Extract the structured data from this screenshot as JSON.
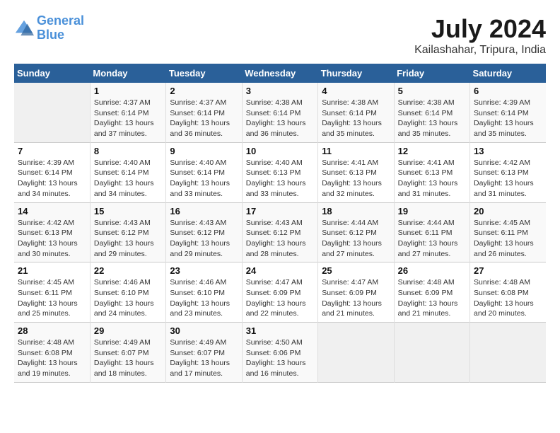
{
  "header": {
    "logo_line1": "General",
    "logo_line2": "Blue",
    "month_year": "July 2024",
    "location": "Kailashahar, Tripura, India"
  },
  "weekdays": [
    "Sunday",
    "Monday",
    "Tuesday",
    "Wednesday",
    "Thursday",
    "Friday",
    "Saturday"
  ],
  "weeks": [
    [
      {
        "day": "",
        "info": ""
      },
      {
        "day": "1",
        "info": "Sunrise: 4:37 AM\nSunset: 6:14 PM\nDaylight: 13 hours\nand 37 minutes."
      },
      {
        "day": "2",
        "info": "Sunrise: 4:37 AM\nSunset: 6:14 PM\nDaylight: 13 hours\nand 36 minutes."
      },
      {
        "day": "3",
        "info": "Sunrise: 4:38 AM\nSunset: 6:14 PM\nDaylight: 13 hours\nand 36 minutes."
      },
      {
        "day": "4",
        "info": "Sunrise: 4:38 AM\nSunset: 6:14 PM\nDaylight: 13 hours\nand 35 minutes."
      },
      {
        "day": "5",
        "info": "Sunrise: 4:38 AM\nSunset: 6:14 PM\nDaylight: 13 hours\nand 35 minutes."
      },
      {
        "day": "6",
        "info": "Sunrise: 4:39 AM\nSunset: 6:14 PM\nDaylight: 13 hours\nand 35 minutes."
      }
    ],
    [
      {
        "day": "7",
        "info": "Sunrise: 4:39 AM\nSunset: 6:14 PM\nDaylight: 13 hours\nand 34 minutes."
      },
      {
        "day": "8",
        "info": "Sunrise: 4:40 AM\nSunset: 6:14 PM\nDaylight: 13 hours\nand 34 minutes."
      },
      {
        "day": "9",
        "info": "Sunrise: 4:40 AM\nSunset: 6:14 PM\nDaylight: 13 hours\nand 33 minutes."
      },
      {
        "day": "10",
        "info": "Sunrise: 4:40 AM\nSunset: 6:13 PM\nDaylight: 13 hours\nand 33 minutes."
      },
      {
        "day": "11",
        "info": "Sunrise: 4:41 AM\nSunset: 6:13 PM\nDaylight: 13 hours\nand 32 minutes."
      },
      {
        "day": "12",
        "info": "Sunrise: 4:41 AM\nSunset: 6:13 PM\nDaylight: 13 hours\nand 31 minutes."
      },
      {
        "day": "13",
        "info": "Sunrise: 4:42 AM\nSunset: 6:13 PM\nDaylight: 13 hours\nand 31 minutes."
      }
    ],
    [
      {
        "day": "14",
        "info": "Sunrise: 4:42 AM\nSunset: 6:13 PM\nDaylight: 13 hours\nand 30 minutes."
      },
      {
        "day": "15",
        "info": "Sunrise: 4:43 AM\nSunset: 6:12 PM\nDaylight: 13 hours\nand 29 minutes."
      },
      {
        "day": "16",
        "info": "Sunrise: 4:43 AM\nSunset: 6:12 PM\nDaylight: 13 hours\nand 29 minutes."
      },
      {
        "day": "17",
        "info": "Sunrise: 4:43 AM\nSunset: 6:12 PM\nDaylight: 13 hours\nand 28 minutes."
      },
      {
        "day": "18",
        "info": "Sunrise: 4:44 AM\nSunset: 6:12 PM\nDaylight: 13 hours\nand 27 minutes."
      },
      {
        "day": "19",
        "info": "Sunrise: 4:44 AM\nSunset: 6:11 PM\nDaylight: 13 hours\nand 27 minutes."
      },
      {
        "day": "20",
        "info": "Sunrise: 4:45 AM\nSunset: 6:11 PM\nDaylight: 13 hours\nand 26 minutes."
      }
    ],
    [
      {
        "day": "21",
        "info": "Sunrise: 4:45 AM\nSunset: 6:11 PM\nDaylight: 13 hours\nand 25 minutes."
      },
      {
        "day": "22",
        "info": "Sunrise: 4:46 AM\nSunset: 6:10 PM\nDaylight: 13 hours\nand 24 minutes."
      },
      {
        "day": "23",
        "info": "Sunrise: 4:46 AM\nSunset: 6:10 PM\nDaylight: 13 hours\nand 23 minutes."
      },
      {
        "day": "24",
        "info": "Sunrise: 4:47 AM\nSunset: 6:09 PM\nDaylight: 13 hours\nand 22 minutes."
      },
      {
        "day": "25",
        "info": "Sunrise: 4:47 AM\nSunset: 6:09 PM\nDaylight: 13 hours\nand 21 minutes."
      },
      {
        "day": "26",
        "info": "Sunrise: 4:48 AM\nSunset: 6:09 PM\nDaylight: 13 hours\nand 21 minutes."
      },
      {
        "day": "27",
        "info": "Sunrise: 4:48 AM\nSunset: 6:08 PM\nDaylight: 13 hours\nand 20 minutes."
      }
    ],
    [
      {
        "day": "28",
        "info": "Sunrise: 4:48 AM\nSunset: 6:08 PM\nDaylight: 13 hours\nand 19 minutes."
      },
      {
        "day": "29",
        "info": "Sunrise: 4:49 AM\nSunset: 6:07 PM\nDaylight: 13 hours\nand 18 minutes."
      },
      {
        "day": "30",
        "info": "Sunrise: 4:49 AM\nSunset: 6:07 PM\nDaylight: 13 hours\nand 17 minutes."
      },
      {
        "day": "31",
        "info": "Sunrise: 4:50 AM\nSunset: 6:06 PM\nDaylight: 13 hours\nand 16 minutes."
      },
      {
        "day": "",
        "info": ""
      },
      {
        "day": "",
        "info": ""
      },
      {
        "day": "",
        "info": ""
      }
    ]
  ]
}
